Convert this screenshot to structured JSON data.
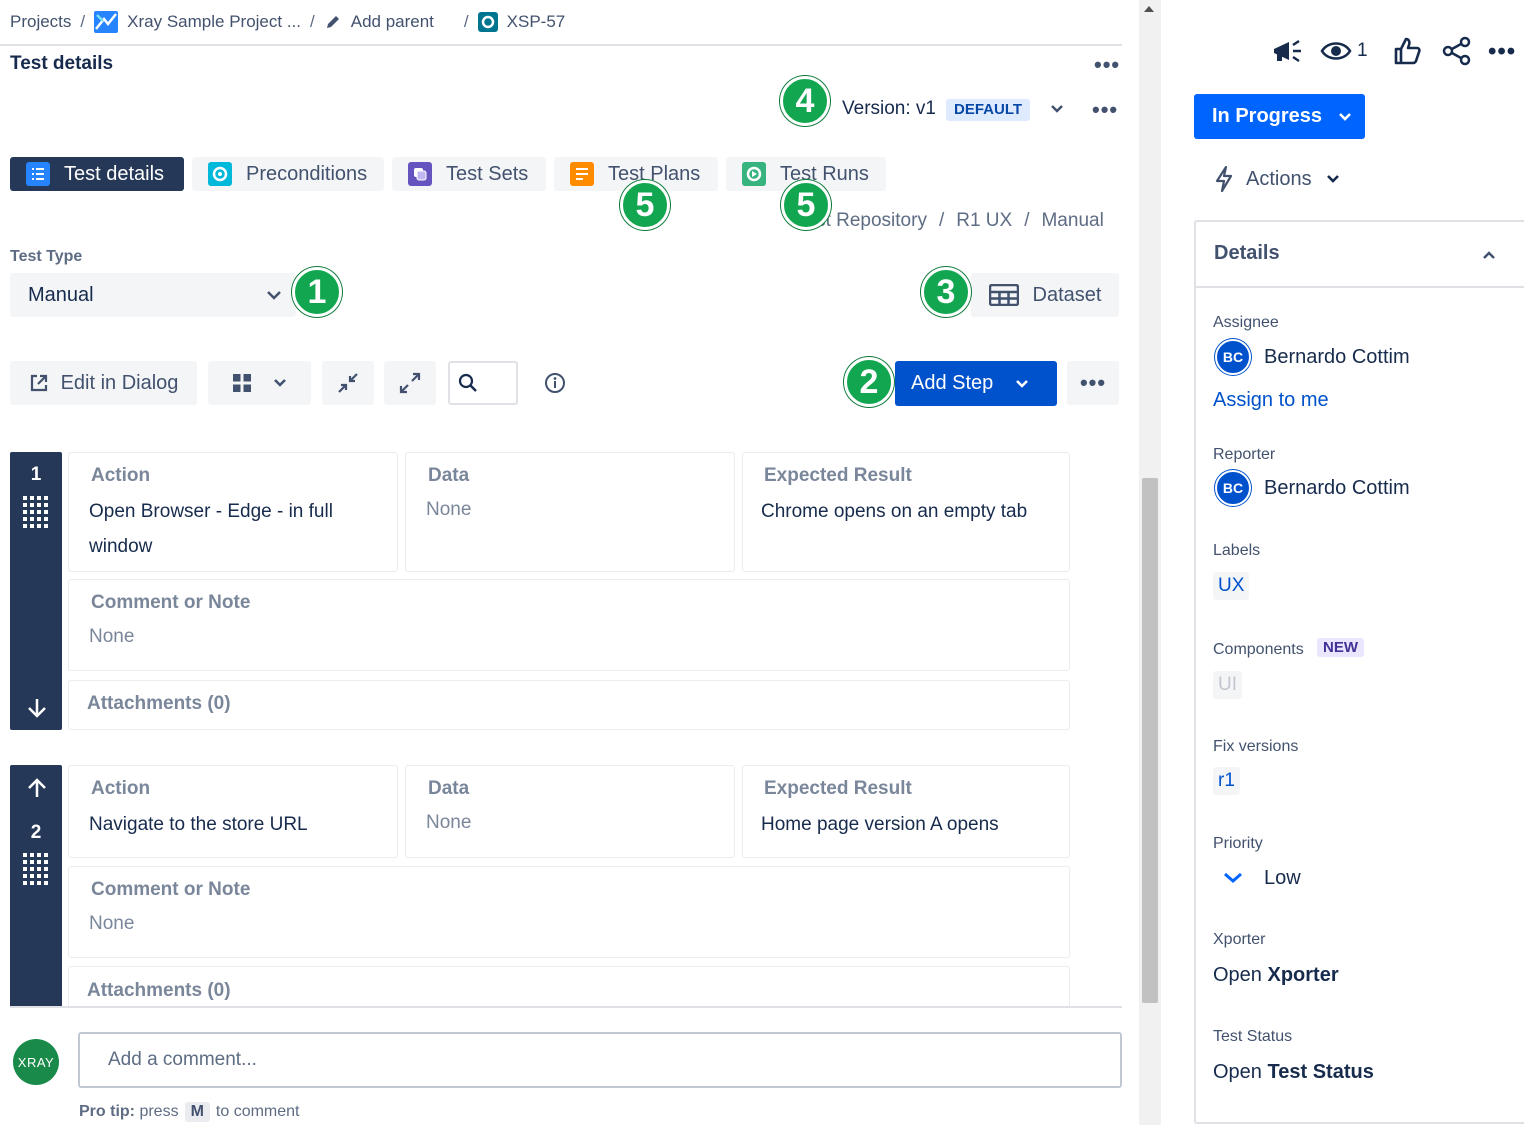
{
  "breadcrumb": {
    "projects": "Projects",
    "project_name": "Xray Sample Project ...",
    "add_parent": "Add parent",
    "issue_key": "XSP-57",
    "sep": "/"
  },
  "header": {
    "title": "Test details",
    "more_dots": "•••"
  },
  "version": {
    "label": "Version: v1",
    "badge": "DEFAULT"
  },
  "tabs": [
    {
      "label": "Test details"
    },
    {
      "label": "Preconditions"
    },
    {
      "label": "Test Sets"
    },
    {
      "label": "Test Plans"
    },
    {
      "label": "Test Runs"
    }
  ],
  "repo_path": {
    "root": "Test Repository",
    "folder1": "R1 UX",
    "folder2": "Manual",
    "sep": "/"
  },
  "test_type": {
    "label": "Test Type",
    "value": "Manual"
  },
  "toolbar": {
    "dataset_label": "Dataset",
    "edit_in_dialog": "Edit in Dialog",
    "add_step": "Add Step",
    "more_dots": "•••"
  },
  "steps": [
    {
      "number": "1",
      "action_label": "Action",
      "action_value": "Open Browser - Edge - in full window",
      "data_label": "Data",
      "data_value": "None",
      "expected_label": "Expected Result",
      "expected_value": "Chrome opens on an empty tab",
      "comment_label": "Comment or Note",
      "comment_value": "None",
      "attachments_label": "Attachments (0)"
    },
    {
      "number": "2",
      "action_label": "Action",
      "action_value": "Navigate to the store URL",
      "data_label": "Data",
      "data_value": "None",
      "expected_label": "Expected Result",
      "expected_value": "Home page version A opens",
      "comment_label": "Comment or Note",
      "comment_value": "None",
      "attachments_label": "Attachments (0)"
    }
  ],
  "comment": {
    "avatar_text": "XRAY",
    "placeholder": "Add a comment...",
    "protip_bold": "Pro tip:",
    "protip_press": "press",
    "protip_key": "M",
    "protip_end": "to comment"
  },
  "sidebar": {
    "watch_count": "1",
    "status": "In Progress",
    "actions": "Actions",
    "details_title": "Details",
    "assignee_label": "Assignee",
    "assignee_initials": "BC",
    "assignee_name": "Bernardo Cottim",
    "assign_to_me": "Assign to me",
    "reporter_label": "Reporter",
    "reporter_initials": "BC",
    "reporter_name": "Bernardo Cottim",
    "labels_label": "Labels",
    "labels_value": "UX",
    "components_label": "Components",
    "components_badge": "NEW",
    "components_value": "UI",
    "fix_versions_label": "Fix versions",
    "fix_versions_value": "r1",
    "priority_label": "Priority",
    "priority_value": "Low",
    "xporter_label": "Xporter",
    "xporter_open": "Open",
    "xporter_name": "Xporter",
    "test_status_label": "Test Status",
    "test_status_open": "Open",
    "test_status_name": "Test Status"
  },
  "callouts": [
    "1",
    "2",
    "3",
    "4",
    "5",
    "5"
  ],
  "colors": {
    "primary_blue": "#0052cc",
    "status_blue": "#0065ff",
    "dark_navy": "#253858",
    "callout_green": "#12a650"
  },
  "icons": {
    "announcement": "megaphone-icon",
    "watch": "eye-icon",
    "like": "thumbs-up-icon",
    "share": "share-icon",
    "actions": "lightning-icon"
  }
}
